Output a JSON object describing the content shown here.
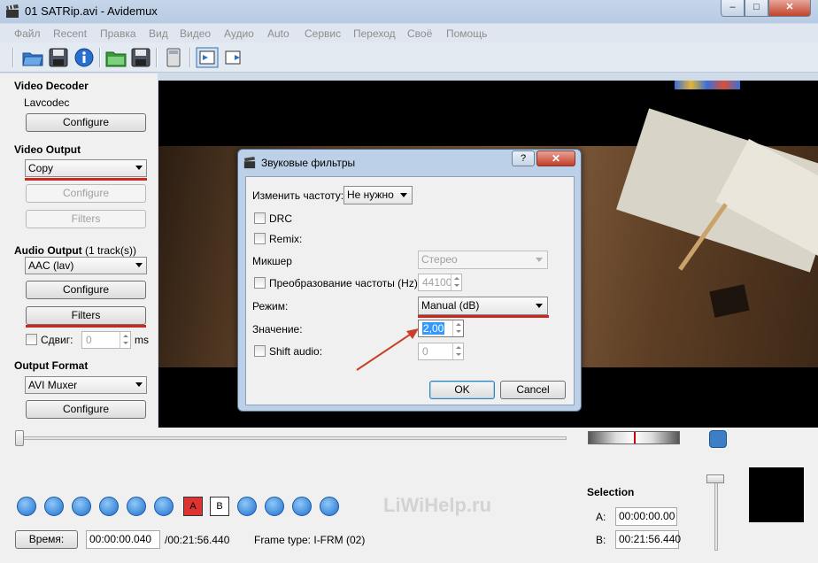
{
  "window": {
    "title": "01 SATRip.avi - Avidemux",
    "minimize": "–",
    "maximize": "□",
    "close": "✕"
  },
  "menu": [
    "Файл",
    "Recent",
    "Правка",
    "Вид",
    "Видео",
    "Аудио",
    "Auto",
    "Сервис",
    "Переход",
    "Своё",
    "Помощь"
  ],
  "left_panel": {
    "video_decoder": {
      "title": "Video Decoder",
      "codec": "Lavcodec",
      "configure": "Configure"
    },
    "video_output": {
      "title": "Video Output",
      "selected": "Copy",
      "configure": "Configure",
      "filters": "Filters"
    },
    "audio_output": {
      "title": "Audio Output",
      "tracks": "(1 track(s))",
      "selected": "AAC (lav)",
      "configure": "Configure",
      "filters": "Filters",
      "shift_label": "Сдвиг:",
      "shift_value": "0",
      "shift_unit": "ms"
    },
    "output_format": {
      "title": "Output Format",
      "selected": "AVI Muxer",
      "configure": "Configure"
    }
  },
  "dialog": {
    "title": "Звуковые фильтры",
    "help": "?",
    "close": "✕",
    "resample_label": "Изменить частоту:",
    "resample_value": "Не нужно",
    "drc_label": "DRC",
    "remix_label": "Remix:",
    "mixer_label": "Микшер",
    "mixer_value": "Стерео",
    "freq_conv_label": "Преобразование частоты (Hz):",
    "freq_conv_value": "44100",
    "mode_label": "Режим:",
    "mode_value": "Manual (dB)",
    "value_label": "Значение:",
    "value_value": "2,00",
    "shift_audio_label": "Shift audio:",
    "shift_audio_value": "0",
    "ok": "OK",
    "cancel": "Cancel"
  },
  "bottom": {
    "time_button": "Время:",
    "current_time": "00:00:00.040",
    "total_time": "/00:21:56.440",
    "frame_type": "Frame type:  I-FRM (02)",
    "selection_title": "Selection",
    "a_label": "A:",
    "a_value": "00:00:00.00",
    "b_label": "B:",
    "b_value": "00:21:56.440",
    "marker_a": "A",
    "marker_b": "B",
    "watermark": "LiWiHelp.ru"
  },
  "colors": {
    "accent_red": "#c8281e",
    "arrow": "#c8402a",
    "control_blue": "#1f6fcf"
  }
}
